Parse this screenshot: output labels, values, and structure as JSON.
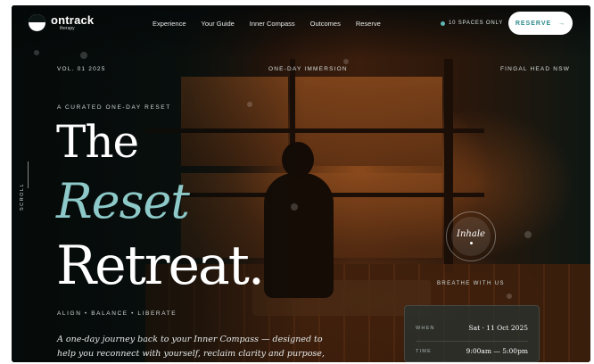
{
  "brand": {
    "name": "ontrack",
    "sub": "therapy"
  },
  "nav": {
    "items": [
      "Experience",
      "Your Guide",
      "Inner Compass",
      "Outcomes",
      "Reserve"
    ]
  },
  "availability": {
    "text": "10 SPACES ONLY"
  },
  "cta": {
    "label": "RESERVE",
    "arrow": "→"
  },
  "meta": {
    "volume": "VOL. 01   2025",
    "format": "ONE-DAY IMMERSION",
    "location": "FINGAL HEAD   NSW"
  },
  "hero": {
    "eyebrow": "A CURATED ONE-DAY RESET",
    "line1": "The",
    "line2": "Reset",
    "line3": "Retreat",
    "line3_dot": ".",
    "tagline": "ALIGN  •  BALANCE  •  LIBERATE",
    "description": "A one-day journey back to your Inner Compass — designed to help you reconnect with yourself, reclaim clarity and purpose, and"
  },
  "scroll": {
    "label": "SCROLL"
  },
  "breathe": {
    "word": "Inhale",
    "label": "BREATHE WITH US"
  },
  "details": {
    "when_label": "WHEN",
    "when_value": "Sat · 11 Oct 2025",
    "time_label": "TIME",
    "time_value": "9:00am — 5:00pm"
  },
  "colors": {
    "accent": "#8cc9c8",
    "button_text": "#2f8a8b",
    "background": "#0b1514"
  },
  "icons": {
    "logo": "half-circle-logo-icon",
    "status": "dot-icon",
    "arrow": "arrow-right-icon"
  }
}
